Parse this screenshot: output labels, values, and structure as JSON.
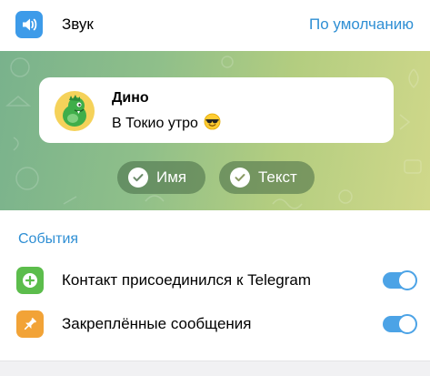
{
  "sound": {
    "icon": "speaker-icon",
    "label": "Звук",
    "value": "По умолчанию",
    "icon_color": "#3d9be9"
  },
  "preview": {
    "contact_name": "Дино",
    "message_text": "В Токио утро",
    "message_emoji": "😎",
    "avatar_icon": "dino-avatar-icon",
    "chips": [
      {
        "label": "Имя",
        "checked": true
      },
      {
        "label": "Текст",
        "checked": true
      }
    ]
  },
  "events": {
    "title": "События",
    "items": [
      {
        "label": "Контакт присоединился к Telegram",
        "icon": "plus-circle-icon",
        "icon_color": "#5cbd4c",
        "enabled": true
      },
      {
        "label": "Закреплённые сообщения",
        "icon": "pin-icon",
        "icon_color": "#f2a337",
        "enabled": true
      }
    ]
  },
  "colors": {
    "accent": "#2f8fd4",
    "toggle_on": "#4ca3e6"
  }
}
